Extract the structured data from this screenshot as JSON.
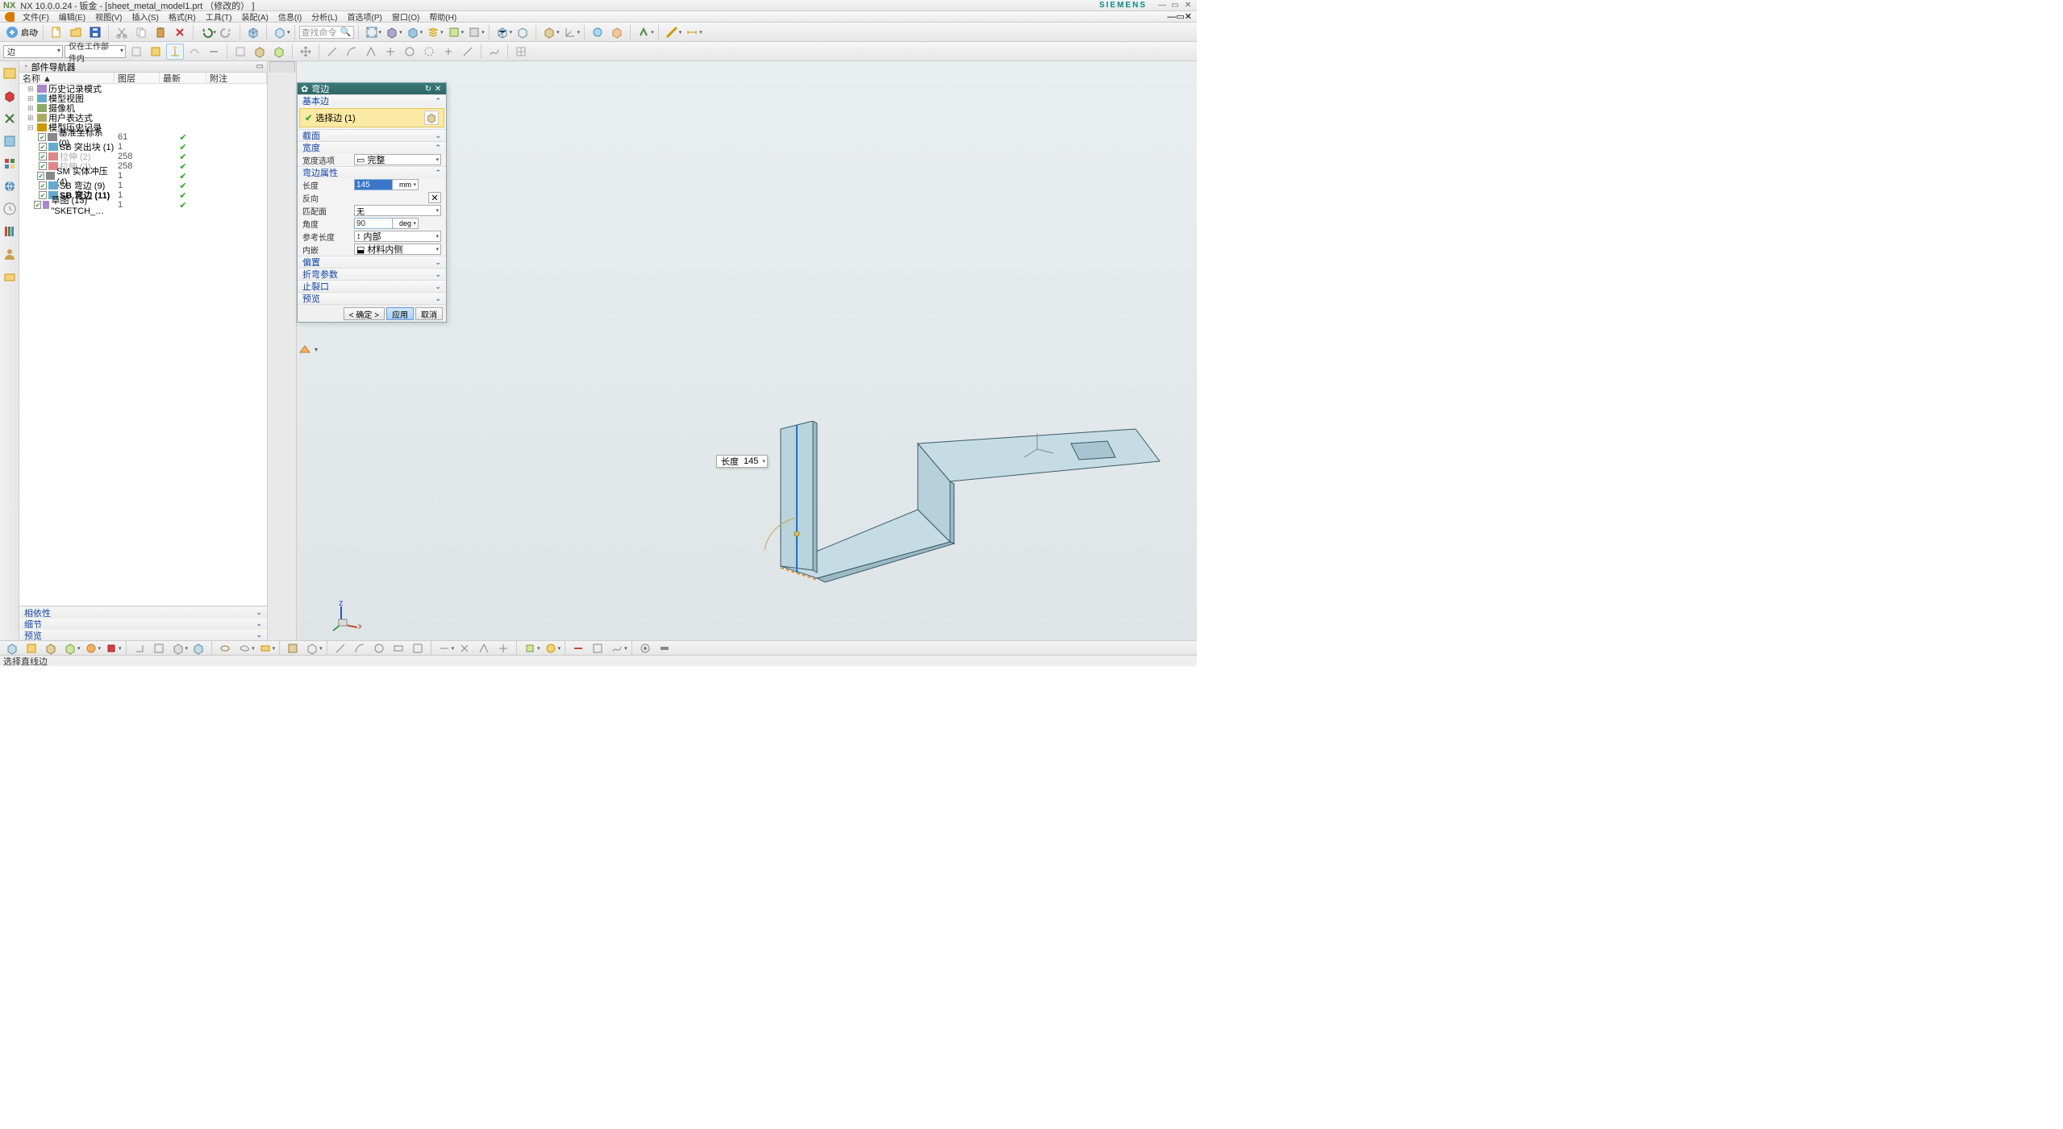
{
  "title": {
    "app": "NX 10.0.0.24",
    "doc": "钣金 - [sheet_metal_model1.prt （修改的） ]"
  },
  "brand": "SIEMENS",
  "menu": {
    "start": "启动",
    "items": [
      "文件(F)",
      "编辑(E)",
      "视图(V)",
      "插入(S)",
      "格式(R)",
      "工具(T)",
      "装配(A)",
      "信息(I)",
      "分析(L)",
      "首选项(P)",
      "窗口(O)",
      "帮助(H)"
    ]
  },
  "toolbar1": {
    "search_placeholder": "查找命令"
  },
  "toolbar2": {
    "combo1": "边",
    "combo2": "仅在工作部件内"
  },
  "navigator": {
    "title": "部件导航器",
    "cols": [
      "名称 ▲",
      "图层",
      "最新",
      "附注"
    ],
    "rows": [
      {
        "indent": 0,
        "icon": "history",
        "label": "历史记录模式",
        "layer": "",
        "ok": false,
        "chk": false
      },
      {
        "indent": 0,
        "icon": "view",
        "label": "模型视图",
        "layer": "",
        "ok": false,
        "chk": false
      },
      {
        "indent": 0,
        "icon": "camera",
        "label": "摄像机",
        "layer": "",
        "ok": false,
        "chk": false
      },
      {
        "indent": 0,
        "icon": "expr",
        "label": "用户表达式",
        "layer": "",
        "ok": false,
        "chk": false
      },
      {
        "indent": 0,
        "icon": "folder",
        "label": "模型历史记录",
        "layer": "",
        "ok": false,
        "chk": false
      },
      {
        "indent": 1,
        "icon": "csys",
        "label": "基准坐标系 (0)",
        "layer": "61",
        "ok": true,
        "chk": true
      },
      {
        "indent": 1,
        "icon": "extr",
        "label": "SB 突出块 (1)",
        "layer": "1",
        "ok": true,
        "chk": true
      },
      {
        "indent": 1,
        "icon": "extr2",
        "label": "拉伸 (2)",
        "layer": "258",
        "ok": true,
        "chk": true,
        "gray": true
      },
      {
        "indent": 1,
        "icon": "extr2",
        "label": "拉伸 (3)",
        "layer": "258",
        "ok": true,
        "chk": true,
        "gray": true
      },
      {
        "indent": 1,
        "icon": "punch",
        "label": "SM 实体冲压 (4)",
        "layer": "1",
        "ok": true,
        "chk": true
      },
      {
        "indent": 1,
        "icon": "bend",
        "label": "SB 弯边 (9)",
        "layer": "1",
        "ok": true,
        "chk": true
      },
      {
        "indent": 1,
        "icon": "bend",
        "label": "SB 弯边 (11)",
        "layer": "1",
        "ok": true,
        "chk": true,
        "bold": true
      },
      {
        "indent": 1,
        "icon": "sketch",
        "label": "草图 (13) \"SKETCH_…",
        "layer": "1",
        "ok": true,
        "chk": true
      }
    ],
    "footer": [
      "相依性",
      "细节",
      "预览"
    ]
  },
  "dialog": {
    "title": "弯边",
    "sec_base": "基本边",
    "select_label": "选择边 (1)",
    "sec_section": "截面",
    "sec_width": "宽度",
    "width_option_lbl": "宽度选项",
    "width_option_val": "完整",
    "sec_props": "弯边属性",
    "length_lbl": "长度",
    "length_val": "145",
    "length_unit": "mm",
    "reverse_lbl": "反向",
    "match_lbl": "匹配面",
    "match_val": "无",
    "angle_lbl": "角度",
    "angle_val": "90",
    "angle_unit": "deg",
    "reflen_lbl": "参考长度",
    "reflen_val": "内部",
    "inset_lbl": "内嵌",
    "inset_val": "材料内侧",
    "sec_offset": "偏置",
    "sec_bendparam": "折弯参数",
    "sec_relief": "止裂口",
    "sec_preview": "预览",
    "btn_ok": "< 确定 >",
    "btn_apply": "应用",
    "btn_cancel": "取消"
  },
  "lentag": {
    "label": "长度",
    "value": "145"
  },
  "status": "选择直线边"
}
